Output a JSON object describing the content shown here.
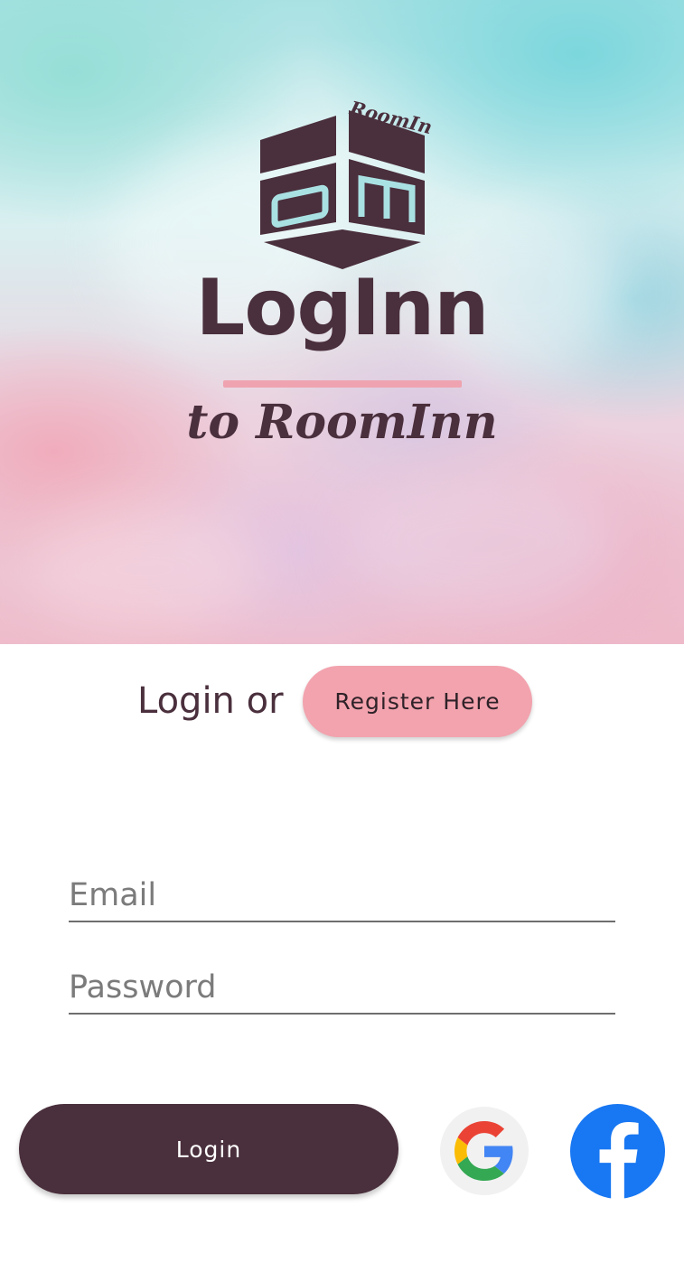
{
  "brand": {
    "logo_text": "RoomInn",
    "title": "LogInn",
    "tagline": "to RoomInn"
  },
  "auth": {
    "login_or": "Login or",
    "register_label": "Register Here",
    "email_placeholder": "Email",
    "password_placeholder": "Password",
    "login_label": "Login"
  },
  "social": {
    "google_icon": "google-icon",
    "facebook_icon": "facebook-icon"
  },
  "colors": {
    "primary": "#4a2f3c",
    "accent": "#f2a3ae",
    "google_blue": "#4285F4",
    "google_red": "#EA4335",
    "google_yellow": "#FBBC05",
    "google_green": "#34A853",
    "facebook_blue": "#1877F2"
  }
}
